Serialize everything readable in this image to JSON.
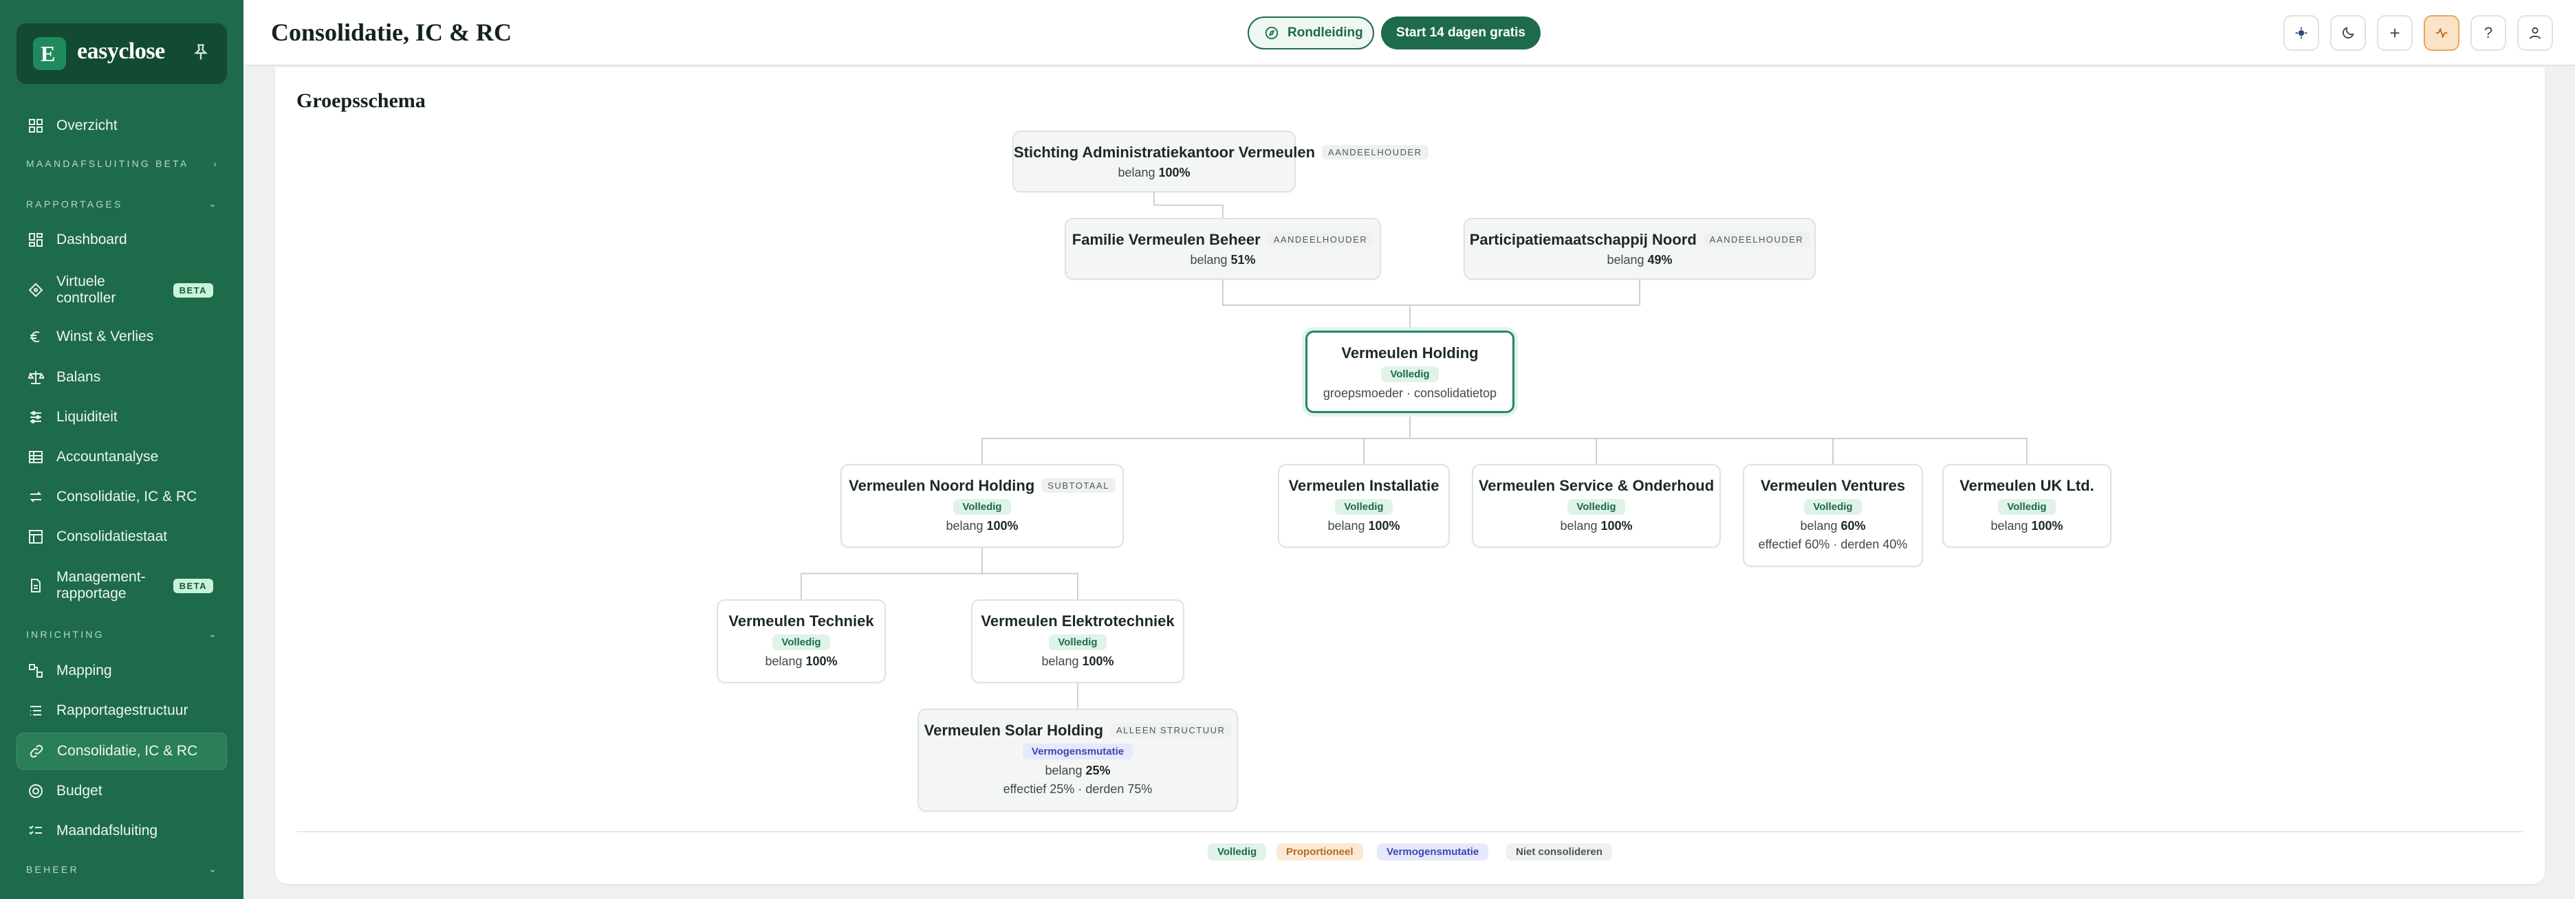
{
  "brand": {
    "name": "easyclose",
    "logo_letter": "E"
  },
  "sidebar": {
    "overview": "Overzicht",
    "sections": {
      "maandafsluiting": "MAANDAFSLUITING  BETA",
      "rapportages": "RAPPORTAGES",
      "inrichting": "INRICHTING",
      "beheer": "BEHEER"
    },
    "rapportages": [
      {
        "label": "Dashboard",
        "icon": "dashboard-icon"
      },
      {
        "label": "Virtuele controller",
        "icon": "diamond-icon",
        "badge": "BETA"
      },
      {
        "label": "Winst & Verlies",
        "icon": "euro-icon"
      },
      {
        "label": "Balans",
        "icon": "scale-icon"
      },
      {
        "label": "Liquiditeit",
        "icon": "sliders-icon"
      },
      {
        "label": "Accountanalyse",
        "icon": "table-icon"
      },
      {
        "label": "Consolidatie, IC & RC",
        "icon": "arrows-icon"
      },
      {
        "label": "Consolidatiestaat",
        "icon": "grid-icon"
      },
      {
        "label": "Management-rapportage",
        "icon": "document-icon",
        "badge": "BETA"
      }
    ],
    "inrichting": [
      {
        "label": "Mapping",
        "icon": "mapping-icon"
      },
      {
        "label": "Rapportagestructuur",
        "icon": "list-icon"
      },
      {
        "label": "Consolidatie, IC & RC",
        "icon": "link-icon",
        "active": true
      },
      {
        "label": "Budget",
        "icon": "target-icon"
      },
      {
        "label": "Maandafsluiting",
        "icon": "checklist-icon"
      }
    ]
  },
  "header": {
    "title": "Consolidatie, IC & RC",
    "tour_label": "Rondleiding",
    "trial_label": "Start 14 dagen gratis"
  },
  "section_title": "Groepsschema",
  "colors": {
    "brand": "#1d6b4a",
    "accent_active": "#1f8a5d"
  },
  "chart_data": {
    "type": "org-chart",
    "nodes": [
      {
        "id": "stak",
        "name": "Stichting Administratiekantoor Vermeulen",
        "tag": "AANDEELHOUDER",
        "belang": "100%"
      },
      {
        "id": "familie",
        "name": "Familie Vermeulen Beheer",
        "tag": "AANDEELHOUDER",
        "belang": "51%"
      },
      {
        "id": "participatie",
        "name": "Participatiemaatschappij Noord",
        "tag": "AANDEELHOUDER",
        "belang": "49%"
      },
      {
        "id": "holding",
        "name": "Vermeulen Holding",
        "badge": "Volledig",
        "note": "groepsmoeder · consolidatietop"
      },
      {
        "id": "noord",
        "name": "Vermeulen Noord Holding",
        "tag": "SUBTOTAAL",
        "badge": "Volledig",
        "belang": "100%"
      },
      {
        "id": "installatie",
        "name": "Vermeulen Installatie",
        "badge": "Volledig",
        "belang": "100%"
      },
      {
        "id": "service",
        "name": "Vermeulen Service & Onderhoud",
        "badge": "Volledig",
        "belang": "100%"
      },
      {
        "id": "ventures",
        "name": "Vermeulen Ventures",
        "badge": "Volledig",
        "belang": "60%",
        "note": "effectief 60% · derden 40%"
      },
      {
        "id": "uk",
        "name": "Vermeulen UK Ltd.",
        "badge": "Volledig",
        "belang": "100%"
      },
      {
        "id": "techniek",
        "name": "Vermeulen Techniek",
        "badge": "Volledig",
        "belang": "100%"
      },
      {
        "id": "elektro",
        "name": "Vermeulen Elektrotechniek",
        "badge": "Volledig",
        "belang": "100%"
      },
      {
        "id": "solar",
        "name": "Vermeulen Solar Holding",
        "tag": "ALLEEN STRUCTUUR",
        "badge": "Vermogensmutatie",
        "belang": "25%",
        "note": "effectief 25% · derden 75%"
      }
    ],
    "edges": [
      [
        "stak",
        "familie"
      ],
      [
        "familie",
        "holding"
      ],
      [
        "participatie",
        "holding"
      ],
      [
        "holding",
        "noord"
      ],
      [
        "holding",
        "installatie"
      ],
      [
        "holding",
        "service"
      ],
      [
        "holding",
        "ventures"
      ],
      [
        "holding",
        "uk"
      ],
      [
        "noord",
        "techniek"
      ],
      [
        "noord",
        "elektro"
      ],
      [
        "elektro",
        "solar"
      ]
    ],
    "belang_label": "belang",
    "legend": [
      "Volledig",
      "Proportioneel",
      "Vermogensmutatie",
      "Niet consolideren"
    ]
  }
}
